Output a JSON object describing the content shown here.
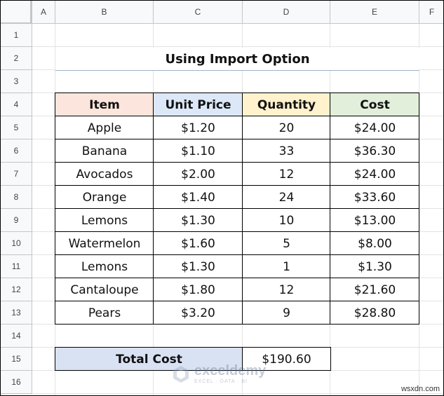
{
  "columns": [
    "A",
    "B",
    "C",
    "D",
    "E",
    "F"
  ],
  "rows": [
    "1",
    "2",
    "3",
    "4",
    "5",
    "6",
    "7",
    "8",
    "9",
    "10",
    "11",
    "12",
    "13",
    "14",
    "15",
    "16"
  ],
  "title": "Using Import Option",
  "table": {
    "headers": [
      "Item",
      "Unit Price",
      "Quantity",
      "Cost"
    ],
    "header_colors": [
      "#fce5dc",
      "#dce8f7",
      "#fff2cc",
      "#e2efda"
    ],
    "rows": [
      [
        "Apple",
        "$1.20",
        "20",
        "$24.00"
      ],
      [
        "Banana",
        "$1.10",
        "33",
        "$36.30"
      ],
      [
        "Avocados",
        "$2.00",
        "12",
        "$24.00"
      ],
      [
        "Orange",
        "$1.40",
        "24",
        "$33.60"
      ],
      [
        "Lemons",
        "$1.30",
        "10",
        "$13.00"
      ],
      [
        "Watermelon",
        "$1.60",
        "5",
        "$8.00"
      ],
      [
        "Lemons",
        "$1.30",
        "1",
        "$1.30"
      ],
      [
        "Cantaloupe",
        "$1.80",
        "12",
        "$21.60"
      ],
      [
        "Pears",
        "$3.20",
        "9",
        "$28.80"
      ]
    ]
  },
  "total": {
    "label": "Total Cost",
    "value": "$190.60",
    "label_color": "#d9e2f3"
  },
  "watermark": {
    "name": "exceldemy",
    "sub": "EXCEL · DATA · BI"
  },
  "credit": "wsxdn.com"
}
